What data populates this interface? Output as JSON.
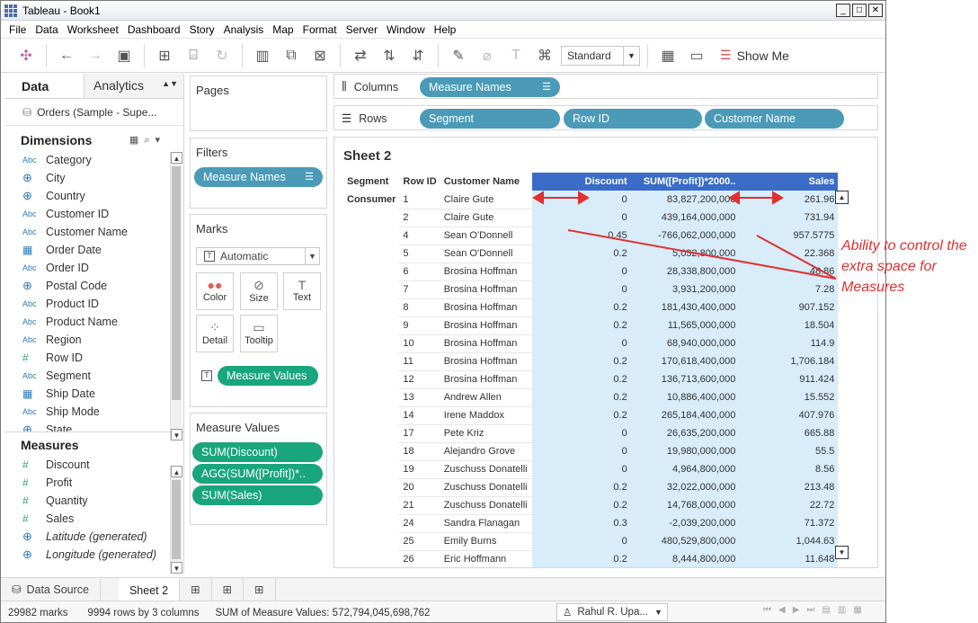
{
  "window": {
    "title": "Tableau - Book1"
  },
  "menu": [
    "File",
    "Data",
    "Worksheet",
    "Dashboard",
    "Story",
    "Analysis",
    "Map",
    "Format",
    "Server",
    "Window",
    "Help"
  ],
  "toolbar": {
    "standard_label": "Standard",
    "show_me_label": "Show Me"
  },
  "left": {
    "tab_data": "Data",
    "tab_analytics": "Analytics",
    "datasource": "Orders (Sample - Supe...",
    "dimensions_title": "Dimensions",
    "dimensions": [
      {
        "icon": "Abc",
        "label": "Category"
      },
      {
        "icon": "globe",
        "label": "City"
      },
      {
        "icon": "globe",
        "label": "Country"
      },
      {
        "icon": "Abc",
        "label": "Customer ID"
      },
      {
        "icon": "Abc",
        "label": "Customer Name"
      },
      {
        "icon": "calendar",
        "label": "Order Date"
      },
      {
        "icon": "Abc",
        "label": "Order ID"
      },
      {
        "icon": "globe",
        "label": "Postal Code"
      },
      {
        "icon": "Abc",
        "label": "Product ID"
      },
      {
        "icon": "Abc",
        "label": "Product Name"
      },
      {
        "icon": "Abc",
        "label": "Region"
      },
      {
        "icon": "#",
        "label": "Row ID"
      },
      {
        "icon": "Abc",
        "label": "Segment"
      },
      {
        "icon": "calendar",
        "label": "Ship Date"
      },
      {
        "icon": "Abc",
        "label": "Ship Mode"
      },
      {
        "icon": "globe",
        "label": "State"
      }
    ],
    "measures_title": "Measures",
    "measures": [
      {
        "icon": "#",
        "label": "Discount"
      },
      {
        "icon": "#",
        "label": "Profit"
      },
      {
        "icon": "#",
        "label": "Quantity"
      },
      {
        "icon": "#",
        "label": "Sales"
      },
      {
        "icon": "globe",
        "label": "Latitude (generated)",
        "italic": true
      },
      {
        "icon": "globe",
        "label": "Longitude (generated)",
        "italic": true
      }
    ]
  },
  "cards": {
    "pages_title": "Pages",
    "filters_title": "Filters",
    "filter_pill": "Measure Names",
    "marks_title": "Marks",
    "marks_type": "Automatic",
    "mark_buttons": [
      "Color",
      "Size",
      "Text",
      "Detail",
      "Tooltip"
    ],
    "marks_pill": "Measure Values",
    "measure_values_title": "Measure Values",
    "measure_value_pills": [
      "SUM(Discount)",
      "AGG(SUM([Profit])*..",
      "SUM(Sales)"
    ]
  },
  "shelves": {
    "columns_label": "Columns",
    "columns_pill": "Measure Names",
    "rows_label": "Rows",
    "rows_pills": [
      "Segment",
      "Row ID",
      "Customer Name"
    ]
  },
  "sheet": {
    "title": "Sheet 2",
    "headers": {
      "segment": "Segment",
      "row_id": "Row ID",
      "customer": "Customer Name",
      "discount": "Discount",
      "profit": "SUM([Profit])*2000..",
      "sales": "Sales"
    },
    "segment_value": "Consumer",
    "rows": [
      [
        "1",
        "Claire Gute",
        "0",
        "83,827,200,000",
        "261.96"
      ],
      [
        "2",
        "Claire Gute",
        "0",
        "439,164,000,000",
        "731.94"
      ],
      [
        "4",
        "Sean O'Donnell",
        "0.45",
        "-766,062,000,000",
        "957.5775"
      ],
      [
        "5",
        "Sean O'Donnell",
        "0.2",
        "5,032,800,000",
        "22.368"
      ],
      [
        "6",
        "Brosina Hoffman",
        "0",
        "28,338,800,000",
        "48.86"
      ],
      [
        "7",
        "Brosina Hoffman",
        "0",
        "3,931,200,000",
        "7.28"
      ],
      [
        "8",
        "Brosina Hoffman",
        "0.2",
        "181,430,400,000",
        "907.152"
      ],
      [
        "9",
        "Brosina Hoffman",
        "0.2",
        "11,565,000,000",
        "18.504"
      ],
      [
        "10",
        "Brosina Hoffman",
        "0",
        "68,940,000,000",
        "114.9"
      ],
      [
        "11",
        "Brosina Hoffman",
        "0.2",
        "170,618,400,000",
        "1,706.184"
      ],
      [
        "12",
        "Brosina Hoffman",
        "0.2",
        "136,713,600,000",
        "911.424"
      ],
      [
        "13",
        "Andrew Allen",
        "0.2",
        "10,886,400,000",
        "15.552"
      ],
      [
        "14",
        "Irene Maddox",
        "0.2",
        "265,184,400,000",
        "407.976"
      ],
      [
        "17",
        "Pete Kriz",
        "0",
        "26,635,200,000",
        "665.88"
      ],
      [
        "18",
        "Alejandro Grove",
        "0",
        "19,980,000,000",
        "55.5"
      ],
      [
        "19",
        "Zuschuss Donatelli",
        "0",
        "4,964,800,000",
        "8.56"
      ],
      [
        "20",
        "Zuschuss Donatelli",
        "0.2",
        "32,022,000,000",
        "213.48"
      ],
      [
        "21",
        "Zuschuss Donatelli",
        "0.2",
        "14,768,000,000",
        "22.72"
      ],
      [
        "24",
        "Sandra Flanagan",
        "0.3",
        "-2,039,200,000",
        "71.372"
      ],
      [
        "25",
        "Emily Burns",
        "0",
        "480,529,800,000",
        "1,044.63"
      ],
      [
        "26",
        "Eric Hoffmann",
        "0.2",
        "8,444,800,000",
        "11.648"
      ]
    ]
  },
  "bottom": {
    "data_source_tab": "Data Source",
    "sheet_tab": "Sheet 2"
  },
  "status": {
    "marks": "29982 marks",
    "rows_cols": "9994 rows by 3 columns",
    "sum": "SUM of Measure Values: 572,794,045,698,762",
    "user": "Rahul R. Upa..."
  },
  "annotation": "Ability to control the extra space for Measures",
  "colors": {
    "pill_blue": "#4b8fb7",
    "pill_green": "#19a67c",
    "header_blue": "#3a6cc8",
    "measure_bg": "#d8ecf9",
    "annotation_red": "#e03030"
  }
}
